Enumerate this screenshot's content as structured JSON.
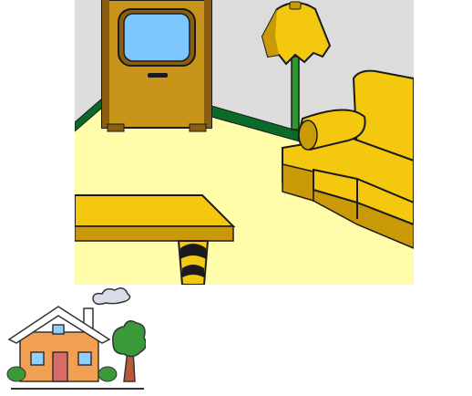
{
  "scene": {
    "name": "living-room-illustration",
    "colors": {
      "wall": "#dcdcdc",
      "floor": "#fffcaa",
      "baseboard": "#0a6a2a",
      "wood": "#c8951a",
      "wood_dark": "#8a5e10",
      "gold": "#f3c80f",
      "gold_shadow": "#c99a05",
      "tv_screen": "#7cc6ff",
      "lamp_pole": "#2e9a2e",
      "outline": "#1a1a1a"
    },
    "objects": [
      "tv-cabinet-icon",
      "floor-lamp-icon",
      "sofa-icon",
      "coffee-table-icon"
    ]
  },
  "nav_icon": {
    "name": "home-icon",
    "colors": {
      "walls": "#f0a050",
      "roof": "#ffffff",
      "door": "#d96a6a",
      "windows": "#8fd0ff",
      "tree": "#3a9a3a",
      "trunk": "#b85a3a",
      "smoke": "#d8dde8"
    }
  }
}
